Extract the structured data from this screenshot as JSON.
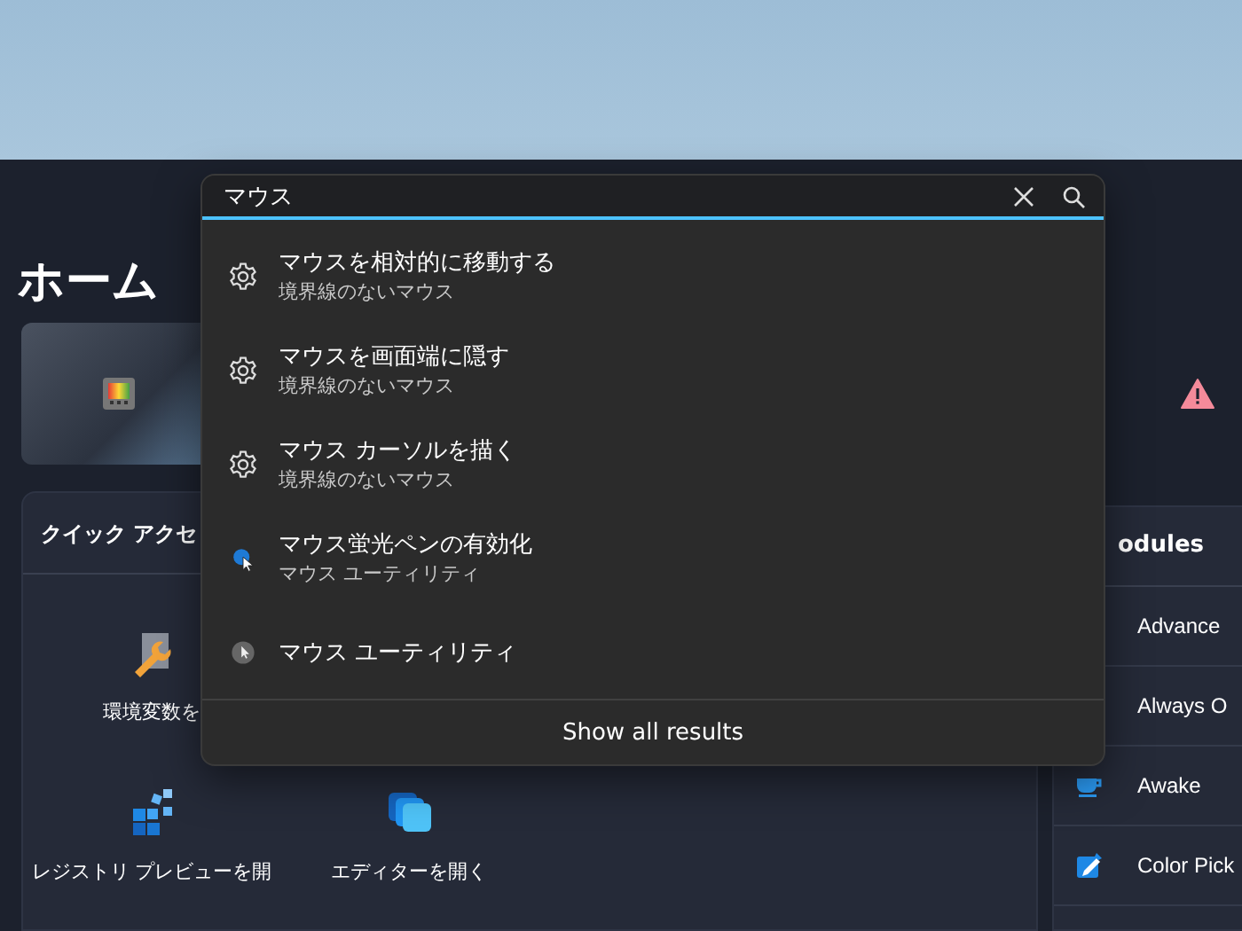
{
  "page_title": "ホーム",
  "search": {
    "value": "マウス"
  },
  "results": [
    {
      "title": "マウスを相対的に移動する",
      "subtitle": "境界線のないマウス",
      "kind": "gear"
    },
    {
      "title": "マウスを画面端に隠す",
      "subtitle": "境界線のないマウス",
      "kind": "gear"
    },
    {
      "title": "マウス カーソルを描く",
      "subtitle": "境界線のないマウス",
      "kind": "gear"
    },
    {
      "title": "マウス蛍光ペンの有効化",
      "subtitle": "マウス ユーティリティ",
      "kind": "highlighter"
    },
    {
      "title": "マウス ユーティリティ",
      "kind": "mouse-utility"
    }
  ],
  "show_all": "Show all results",
  "quick_access": {
    "title": "クイック アクセ",
    "items": [
      {
        "label": "環境変数を",
        "kind": "wrench"
      },
      {
        "kind": "none"
      },
      {
        "kind": "none"
      },
      {
        "label": "レジストリ プレビューを開",
        "kind": "registry"
      },
      {
        "label": "エディターを開く",
        "kind": "editor"
      }
    ]
  },
  "modules": {
    "title": "odules",
    "items": [
      {
        "label": "Advance",
        "kind": "none"
      },
      {
        "label": "Always O",
        "kind": "none"
      },
      {
        "label": "Awake",
        "kind": "cup"
      },
      {
        "label": "Color Pick",
        "kind": "picker"
      }
    ]
  }
}
